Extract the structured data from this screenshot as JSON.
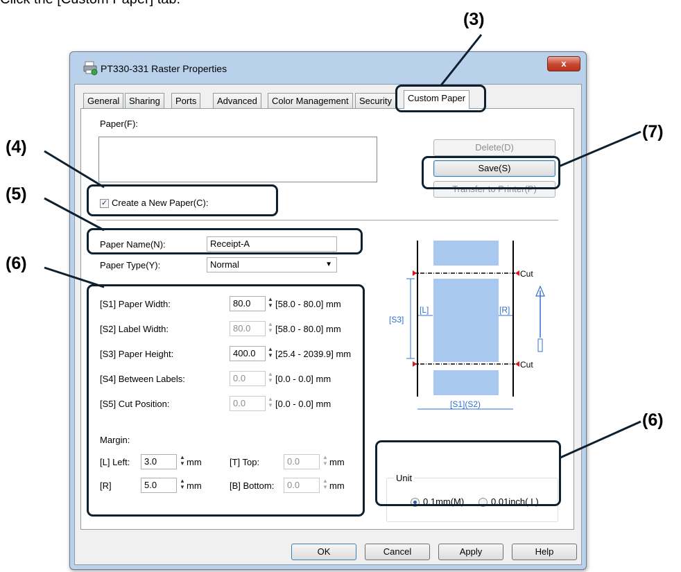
{
  "instruction_text": "Click the [Custom Paper] tab.",
  "callouts": {
    "c3": "(3)",
    "c4": "(4)",
    "c5": "(5)",
    "c6a": "(6)",
    "c6b": "(6)",
    "c7": "(7)"
  },
  "window": {
    "title": "PT330-331 Raster Properties",
    "close_label": "x",
    "tabs": [
      "General",
      "Sharing",
      "Ports",
      "Advanced",
      "Color Management",
      "Security",
      "Custom Paper"
    ],
    "active_tab": "Custom Paper"
  },
  "paper_section": {
    "paper_label": "Paper(F):",
    "delete_label": "Delete(D)",
    "save_label": "Save(S)",
    "transfer_label": "Transfer to Printer(P)",
    "create_new_label": "Create a New Paper(C):",
    "create_new_checked": true
  },
  "paper_settings": {
    "name_label": "Paper Name(N):",
    "name_value": "Receipt-A",
    "type_label": "Paper Type(Y):",
    "type_value": "Normal",
    "s1_label": "[S1] Paper Width:",
    "s1_value": "80.0",
    "s1_range": "[58.0 - 80.0] mm",
    "s2_label": "[S2] Label Width:",
    "s2_value": "80.0",
    "s2_range": "[58.0 - 80.0] mm",
    "s3_label": "[S3] Paper Height:",
    "s3_value": "400.0",
    "s3_range": "[25.4 - 2039.9] mm",
    "s4_label": "[S4] Between Labels:",
    "s4_value": "0.0",
    "s4_range": "[0.0 - 0.0] mm",
    "s5_label": "[S5] Cut Position:",
    "s5_value": "0.0",
    "s5_range": "[0.0 - 0.0] mm",
    "margin_label": "Margin:",
    "left_label": "[L] Left:",
    "left_value": "3.0",
    "left_unit": "mm",
    "right_label": "[R]",
    "right_value": "5.0",
    "right_unit": "mm",
    "top_label": "[T] Top:",
    "top_value": "0.0",
    "top_unit": "mm",
    "bottom_label": "[B] Bottom:",
    "bottom_value": "0.0",
    "bottom_unit": "mm"
  },
  "diagram": {
    "cut_top": "Cut",
    "cut_bottom": "Cut",
    "l_label": "[L]",
    "r_label": "[R]",
    "s3_label": "[S3]",
    "s1s2_label": "[S1](S2)"
  },
  "unit_group": {
    "title": "Unit",
    "mm_label": "0.1mm(M)",
    "inch_label": "0.01inch( I )",
    "selected": "0.1mm(M)"
  },
  "footer": {
    "ok_label": "OK",
    "cancel_label": "Cancel",
    "apply_label": "Apply",
    "help_label": "Help"
  },
  "colors": {
    "paper_fill": "#a9c8ef",
    "marker_red": "#e0141e",
    "diagram_blue": "#2f6fd0"
  }
}
